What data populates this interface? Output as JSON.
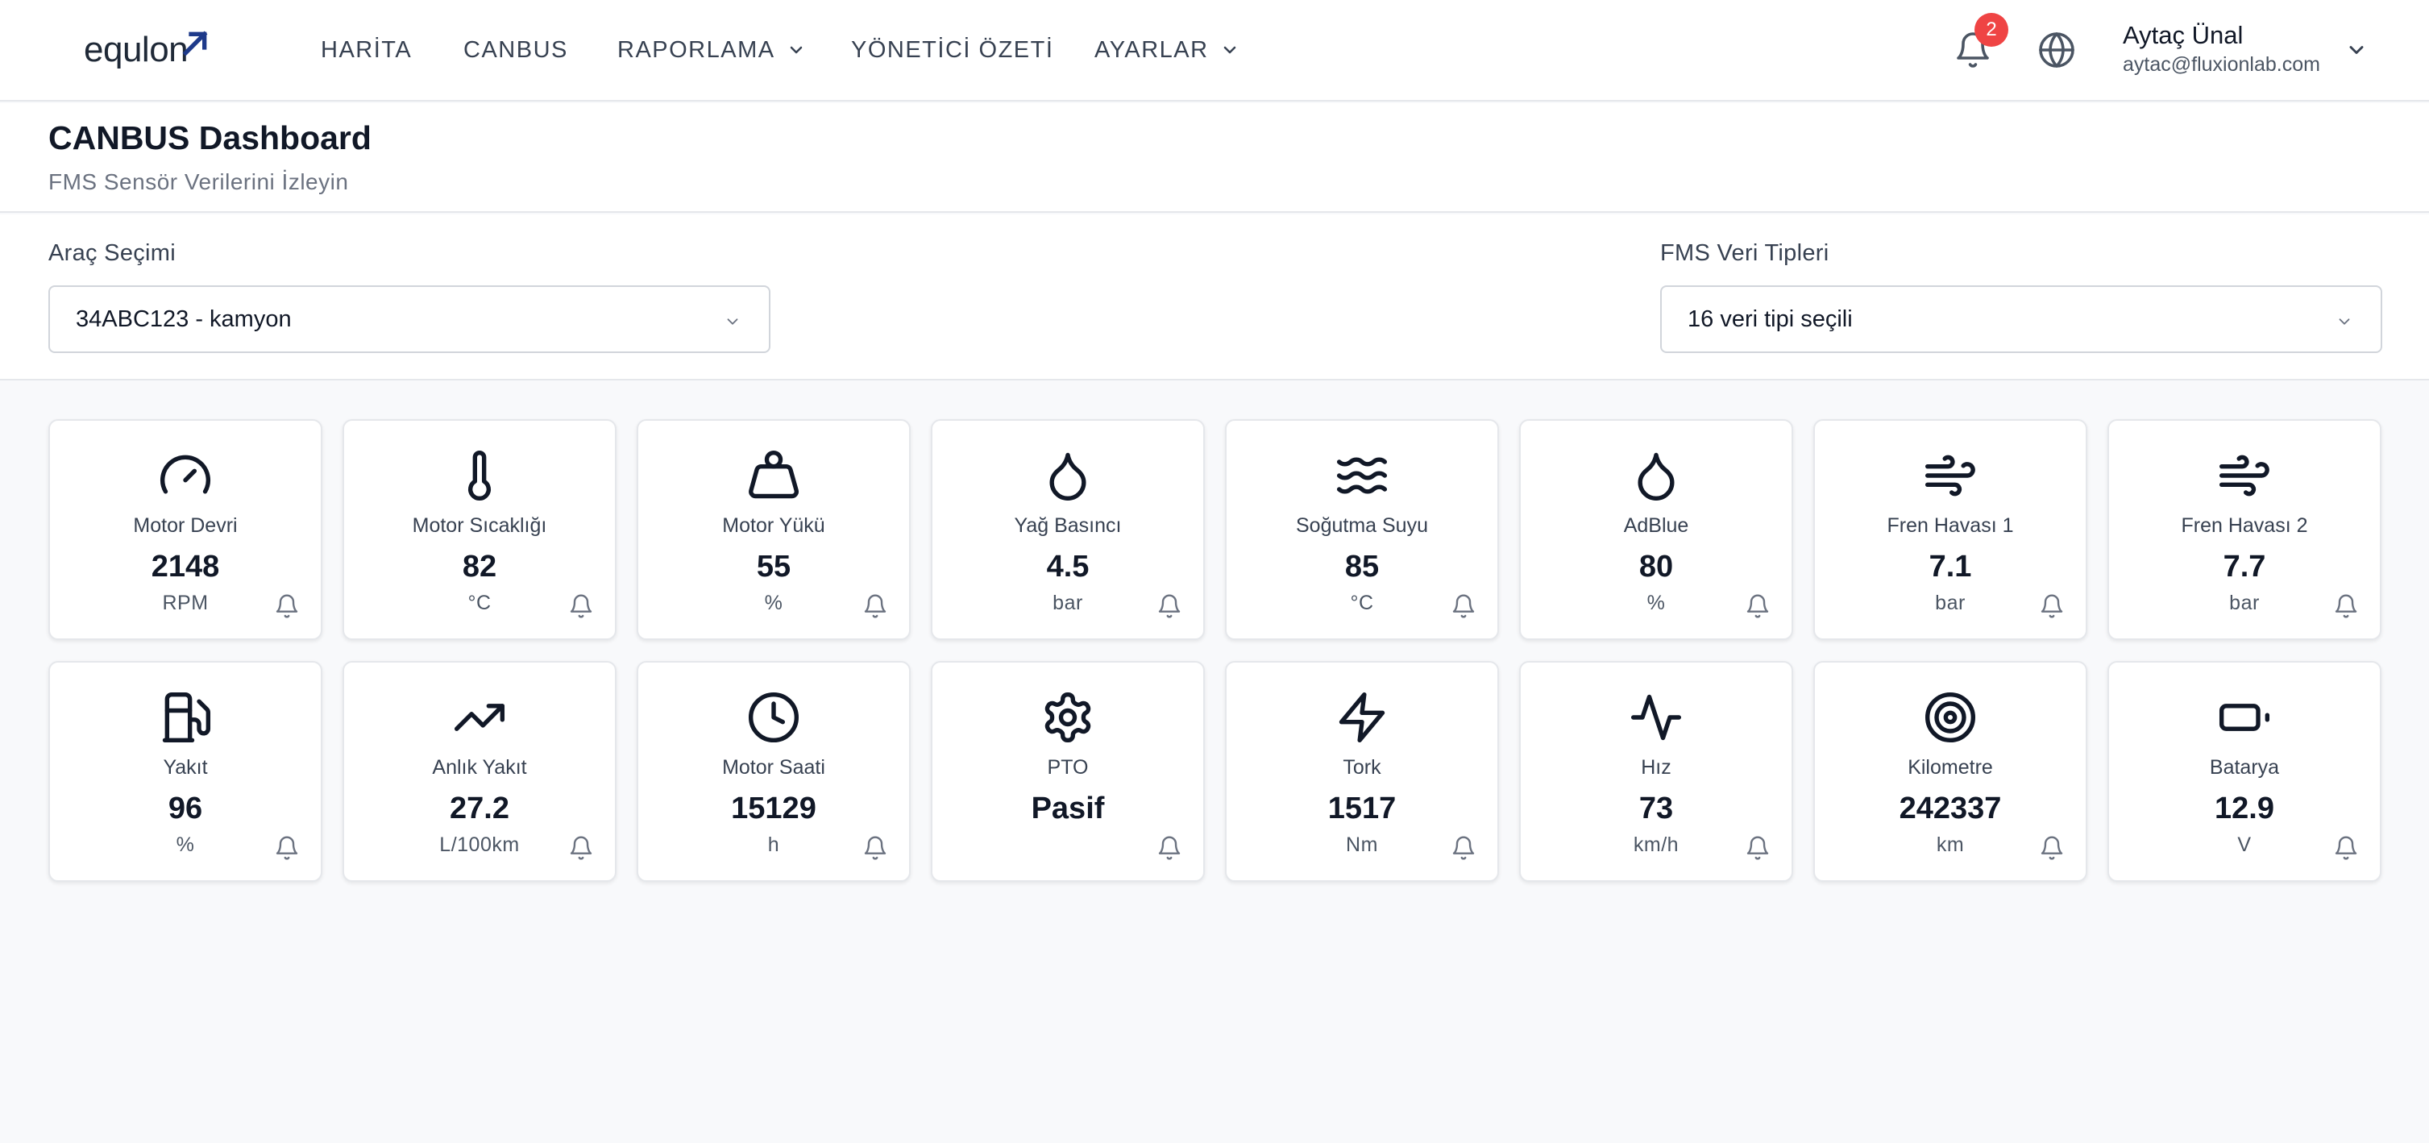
{
  "brand": {
    "name": "equlon",
    "accent": "#1e3a8a"
  },
  "nav": {
    "items": [
      {
        "label": "HARİTA"
      },
      {
        "label": "CANBUS"
      },
      {
        "label": "RAPORLAMA"
      },
      {
        "label": "YÖNETİCİ ÖZETİ"
      },
      {
        "label": "AYARLAR"
      }
    ]
  },
  "notifications": {
    "count": "2",
    "badge_color": "#ef4444"
  },
  "user": {
    "name": "Aytaç Ünal",
    "email": "aytac@fluxionlab.com"
  },
  "header": {
    "title": "CANBUS Dashboard",
    "subtitle": "FMS Sensör Verilerini İzleyin"
  },
  "filters": {
    "vehicle": {
      "label": "Araç Seçimi",
      "value": "34ABC123 - kamyon"
    },
    "types": {
      "label": "FMS Veri Tipleri",
      "value": "16 veri tipi seçili"
    }
  },
  "cards": [
    {
      "icon": "gauge-icon",
      "label": "Motor Devri",
      "value": "2148",
      "unit": "RPM"
    },
    {
      "icon": "thermometer-icon",
      "label": "Motor Sıcaklığı",
      "value": "82",
      "unit": "°C"
    },
    {
      "icon": "weight-icon",
      "label": "Motor Yükü",
      "value": "55",
      "unit": "%"
    },
    {
      "icon": "droplet-icon",
      "label": "Yağ Basıncı",
      "value": "4.5",
      "unit": "bar"
    },
    {
      "icon": "waves-icon",
      "label": "Soğutma Suyu",
      "value": "85",
      "unit": "°C"
    },
    {
      "icon": "droplet-icon",
      "label": "AdBlue",
      "value": "80",
      "unit": "%"
    },
    {
      "icon": "wind-icon",
      "label": "Fren Havası 1",
      "value": "7.1",
      "unit": "bar"
    },
    {
      "icon": "wind-icon",
      "label": "Fren Havası 2",
      "value": "7.7",
      "unit": "bar"
    },
    {
      "icon": "fuel-icon",
      "label": "Yakıt",
      "value": "96",
      "unit": "%"
    },
    {
      "icon": "trending-up-icon",
      "label": "Anlık Yakıt",
      "value": "27.2",
      "unit": "L/100km"
    },
    {
      "icon": "clock-icon",
      "label": "Motor Saati",
      "value": "15129",
      "unit": "h"
    },
    {
      "icon": "gear-icon",
      "label": "PTO",
      "value": "Pasif",
      "unit": ""
    },
    {
      "icon": "zap-icon",
      "label": "Tork",
      "value": "1517",
      "unit": "Nm"
    },
    {
      "icon": "activity-icon",
      "label": "Hız",
      "value": "73",
      "unit": "km/h"
    },
    {
      "icon": "target-icon",
      "label": "Kilometre",
      "value": "242337",
      "unit": "km"
    },
    {
      "icon": "battery-icon",
      "label": "Batarya",
      "value": "12.9",
      "unit": "V"
    }
  ]
}
